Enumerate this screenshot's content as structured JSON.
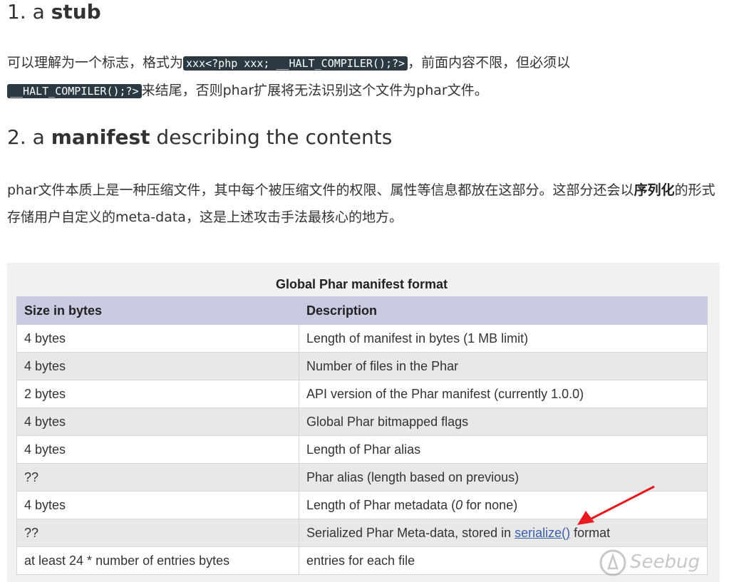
{
  "section1": {
    "number": "1. a ",
    "keyword": "stub",
    "para_part1": "可以理解为一个标志，格式为",
    "code1": "xxx<?php xxx; __HALT_COMPILER();?>",
    "para_part2": "，前面内容不限，但必须以",
    "code2": "__HALT_COMPILER();?>",
    "para_part3": "来结尾，否则phar扩展将无法识别这个文件为phar文件。"
  },
  "section2": {
    "number": "2. a ",
    "keyword": "manifest",
    "rest": " describing the contents",
    "para_part1": "phar文件本质上是一种压缩文件，其中每个被压缩文件的权限、属性等信息都放在这部分。这部分还会以",
    "bold": "序列化",
    "para_part2": "的形式存储用户自定义的meta-data，这是上述攻击手法最核心的地方。"
  },
  "table": {
    "caption": "Global Phar manifest format",
    "headers": [
      "Size in bytes",
      "Description"
    ],
    "rows": [
      {
        "size": "4 bytes",
        "desc": "Length of manifest in bytes (1 MB limit)"
      },
      {
        "size": "4 bytes",
        "desc": "Number of files in the Phar"
      },
      {
        "size": "2 bytes",
        "desc": "API version of the Phar manifest (currently 1.0.0)"
      },
      {
        "size": "4 bytes",
        "desc": "Global Phar bitmapped flags"
      },
      {
        "size": "4 bytes",
        "desc": "Length of Phar alias"
      },
      {
        "size": "??",
        "desc": "Phar alias (length based on previous)"
      },
      {
        "size": "4 bytes",
        "desc_pre": "Length of Phar metadata (",
        "desc_em": "0",
        "desc_post": " for none)"
      },
      {
        "size": "??",
        "desc_pre": "Serialized Phar Meta-data, stored in ",
        "desc_link": "serialize()",
        "desc_post": " format"
      },
      {
        "size": "at least 24 * number of entries bytes",
        "desc": "entries for each file"
      }
    ]
  },
  "watermark": "Seebug",
  "colors": {
    "code_bg": "#2b3a42",
    "header_bg": "#c8cbe0",
    "arrow": "#e8191f",
    "link": "#3b5ea8"
  }
}
